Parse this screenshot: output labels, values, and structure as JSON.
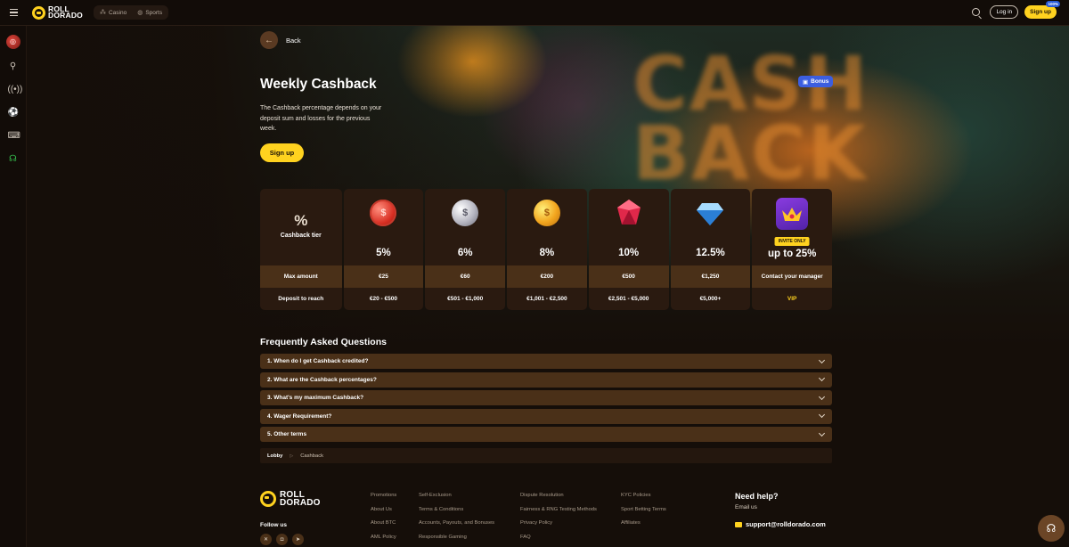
{
  "header": {
    "brand_line1": "ROLL",
    "brand_line2": "DORADO",
    "nav": [
      {
        "label": "Casino",
        "icon": "dice-icon"
      },
      {
        "label": "Sports",
        "icon": "ball-icon"
      }
    ],
    "login_label": "Log in",
    "signup_label": "Sign up",
    "signup_badge": "100%"
  },
  "sidebar": {
    "items": [
      {
        "icon": "casino-roulette-icon"
      },
      {
        "icon": "bike-icon"
      },
      {
        "icon": "live-broadcast-icon"
      },
      {
        "icon": "soccer-ball-icon"
      },
      {
        "icon": "gamepad-icon"
      },
      {
        "icon": "headset-icon"
      }
    ]
  },
  "hero": {
    "back_label": "Back",
    "title": "Weekly Cashback",
    "description": "The Cashback percentage depends on your deposit sum and losses for the previous week.",
    "signup_label": "Sign up",
    "bonus_badge": "Bonus"
  },
  "tiers": {
    "label_icon": "%",
    "label_title": "Cashback tier",
    "row1_label": "Max amount",
    "row2_label": "Deposit to reach",
    "columns": [
      {
        "icon": "red-coin-icon",
        "percent": "5%",
        "max": "€25",
        "deposit": "€20 - €500"
      },
      {
        "icon": "silver-coin-icon",
        "percent": "6%",
        "max": "€60",
        "deposit": "€501 - €1,000"
      },
      {
        "icon": "gold-coin-icon",
        "percent": "8%",
        "max": "€200",
        "deposit": "€1,001 - €2,500"
      },
      {
        "icon": "ruby-gem-icon",
        "percent": "10%",
        "max": "€500",
        "deposit": "€2,501 - €5,000"
      },
      {
        "icon": "diamond-gem-icon",
        "percent": "12.5%",
        "max": "€1,250",
        "deposit": "€5,000+"
      }
    ],
    "vip": {
      "icon": "crown-icon",
      "badge": "INVITE ONLY",
      "percent": "up to 25%",
      "max": "Contact your manager",
      "deposit": "VIP"
    }
  },
  "faq": {
    "title": "Frequently Asked Questions",
    "items": [
      "1.  When do I get Cashback credited?",
      "2.  What are the Cashback percentages?",
      "3.  What's my maximum Cashback?",
      "4.  Wager Requirement?",
      "5.  Other terms"
    ]
  },
  "breadcrumb": {
    "lobby": "Lobby",
    "current": "Cashback"
  },
  "footer": {
    "brand_line1": "ROLL",
    "brand_line2": "DORADO",
    "follow_label": "Follow us",
    "socials": [
      "x-icon",
      "instagram-icon",
      "telegram-icon"
    ],
    "col1": [
      "Promotions",
      "About Us",
      "About BTC",
      "AML Policy"
    ],
    "col2": [
      "Self-Exclusion",
      "Terms & Conditions",
      "Accounts, Payouts, and Bonuses",
      "Responsible Gaming"
    ],
    "col3": [
      "Dispute Resolution",
      "Fairness & RNG Testing Methods",
      "Privacy Policy",
      "FAQ"
    ],
    "col4": [
      "KYC Policies",
      "Sport Betting Terms",
      "Affiliates"
    ],
    "need_help": "Need help?",
    "email_us": "Email us",
    "support_email": "support@rolldorado.com"
  },
  "colors": {
    "accent": "#ffd21f",
    "background": "#150e09",
    "panel": "#2a1a10",
    "row_highlight": "#4a3018",
    "bonus": "#3c5ee0"
  }
}
